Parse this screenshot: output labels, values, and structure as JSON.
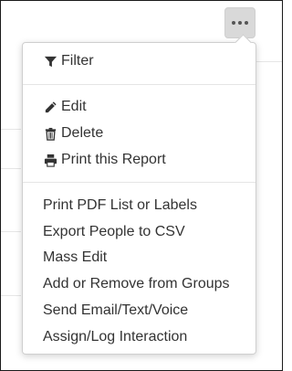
{
  "toolbar": {
    "more_label": ""
  },
  "menu": {
    "filter": "Filter",
    "edit": "Edit",
    "delete": "Delete",
    "print_report": "Print this Report",
    "print_pdf": "Print PDF List or Labels",
    "export_csv": "Export People to CSV",
    "mass_edit": "Mass Edit",
    "add_remove_groups": "Add or Remove from Groups",
    "send_message": "Send Email/Text/Voice",
    "assign_interaction": "Assign/Log Interaction"
  },
  "icons": {
    "filter": "filter-icon",
    "edit": "pencil-icon",
    "delete": "trash-icon",
    "print": "printer-icon",
    "more": "ellipsis-icon"
  },
  "colors": {
    "text": "#333333",
    "button_bg": "#d9d9d9",
    "separator": "#e5e5e5"
  }
}
